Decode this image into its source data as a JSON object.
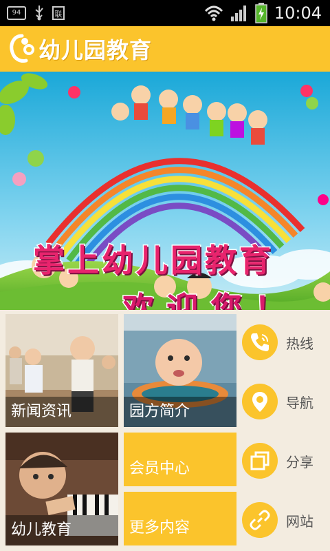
{
  "status_bar": {
    "notification_badge": "94",
    "time": "10:04"
  },
  "app": {
    "title": "幼儿园教育"
  },
  "banner": {
    "title": "掌上幼儿园教育",
    "subtitle": "欢迎您！"
  },
  "tiles": [
    {
      "label": "新闻资讯"
    },
    {
      "label": "园方简介"
    },
    {
      "label": "幼儿教育"
    }
  ],
  "yellow_tiles": [
    {
      "label": "会员中心"
    },
    {
      "label": "更多内容"
    }
  ],
  "side_actions": [
    {
      "label": "热线",
      "icon": "phone-icon"
    },
    {
      "label": "导航",
      "icon": "location-pin-icon"
    },
    {
      "label": "分享",
      "icon": "share-icon"
    },
    {
      "label": "网站",
      "icon": "link-icon"
    }
  ],
  "colors": {
    "accent": "#fbc42c",
    "status_bar": "#000000",
    "banner_text": "#e8246d"
  }
}
